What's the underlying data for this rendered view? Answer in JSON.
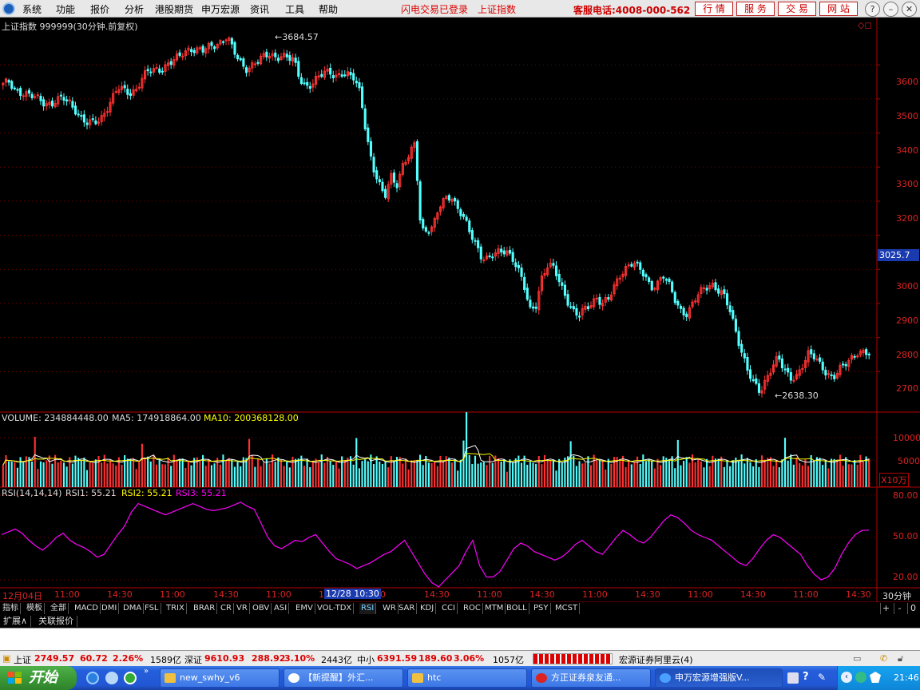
{
  "menubar": {
    "items": [
      "系统",
      "功能",
      "报价",
      "分析",
      "港股期货",
      "申万宏源",
      "资讯",
      "工具",
      "帮助"
    ],
    "notice1": "闪电交易已登录",
    "notice2": "上证指数",
    "hotline": "客服电话:4008-000-562",
    "buttons": [
      "行 情",
      "服 务",
      "交 易",
      "网 站"
    ]
  },
  "chart": {
    "title": "上证指数 999999(30分钟.前复权)",
    "high_label": "3684.57",
    "low_label": "2638.30",
    "current_price": "3025.7",
    "price_ticks": [
      "3600",
      "3500",
      "3400",
      "3300",
      "3200",
      "3100",
      "3000",
      "2900",
      "2800",
      "2700"
    ],
    "volume_label": "VOLUME: 234884448.00",
    "ma5_label": "MA5: 174918864.00",
    "ma10_label": "MA10: 200368128.00",
    "volume_ticks": [
      "10000",
      "5000"
    ],
    "volume_unit": "X10万",
    "rsi_label": "RSI(14,14,14)",
    "rsi1_label": "RSI1: 55.21",
    "rsi2_label": "RSI2: 55.21",
    "rsi3_label": "RSI3: 55.21",
    "rsi_ticks": [
      "80.00",
      "50.00",
      "20.00"
    ],
    "time_labels": [
      "12月04日",
      "11:00",
      "14:30",
      "11:00",
      "14:30",
      "11:00",
      "1",
      "12/28 10:30",
      "0",
      "14:30",
      "11:00",
      "14:30",
      "11:00",
      "14:30",
      "11:00",
      "14:30",
      "11:00",
      "14:30"
    ],
    "period": "30分钟",
    "colors": {
      "up": "#ff3232",
      "down": "#54ffff",
      "ma5": "#ffffff",
      "ma10": "#ffff00",
      "rsi": "#ff00ff",
      "axis": "#b40000"
    }
  },
  "chart_data": {
    "type": "candlestick",
    "title": "上证指数 999999(30分钟.前复权)",
    "ylim": [
      2600,
      3720
    ],
    "close_path": [
      3540,
      3550,
      3530,
      3520,
      3510,
      3505,
      3500,
      3490,
      3485,
      3495,
      3500,
      3490,
      3470,
      3440,
      3425,
      3430,
      3440,
      3470,
      3500,
      3530,
      3525,
      3520,
      3530,
      3560,
      3580,
      3585,
      3590,
      3600,
      3610,
      3620,
      3640,
      3650,
      3645,
      3640,
      3650,
      3660,
      3670,
      3684.57,
      3640,
      3610,
      3590,
      3600,
      3610,
      3620,
      3630,
      3625,
      3630,
      3620,
      3610,
      3560,
      3540,
      3545,
      3560,
      3575,
      3580,
      3570,
      3575,
      3565,
      3560,
      3520,
      3400,
      3300,
      3250,
      3210,
      3280,
      3250,
      3300,
      3330,
      3370,
      3120,
      3115,
      3120,
      3180,
      3210,
      3220,
      3180,
      3150,
      3110,
      3080,
      3040,
      3030,
      3040,
      3050,
      3060,
      3040,
      3000,
      2950,
      2880,
      2900,
      2980,
      3010,
      3000,
      2960,
      2920,
      2880,
      2860,
      2880,
      2900,
      2920,
      2900,
      2910,
      2950,
      2990,
      3010,
      3020,
      3000,
      2980,
      2950,
      2960,
      2980,
      2950,
      2910,
      2880,
      2870,
      2900,
      2930,
      2950,
      2960,
      2940,
      2920,
      2880,
      2820,
      2760,
      2700,
      2660,
      2638.3,
      2680,
      2720,
      2740,
      2700,
      2680,
      2690,
      2720,
      2750,
      2740,
      2720,
      2700,
      2680,
      2700,
      2720,
      2740,
      2760,
      2755,
      2749.57
    ],
    "volume_ticks": [
      10000,
      5000
    ],
    "volume_unit": "X10万",
    "volume": 234884448.0,
    "ma5": 174918864.0,
    "ma10": 200368128.0,
    "rsi_path": [
      52,
      54,
      56,
      53,
      48,
      44,
      41,
      45,
      50,
      53,
      48,
      45,
      43,
      40,
      36,
      38,
      45,
      52,
      58,
      68,
      74,
      72,
      70,
      68,
      66,
      68,
      70,
      72,
      74,
      72,
      70,
      69,
      70,
      71,
      73,
      75,
      72,
      70,
      60,
      50,
      44,
      42,
      45,
      48,
      47,
      50,
      52,
      46,
      40,
      35,
      33,
      31,
      28,
      30,
      32,
      35,
      38,
      40,
      44,
      48,
      40,
      32,
      24,
      18,
      15,
      20,
      25,
      30,
      40,
      48,
      30,
      22,
      22,
      26,
      34,
      42,
      46,
      44,
      40,
      38,
      36,
      34,
      36,
      40,
      45,
      48,
      44,
      40,
      38,
      44,
      50,
      55,
      52,
      48,
      46,
      50,
      56,
      62,
      66,
      64,
      60,
      55,
      52,
      50,
      48,
      44,
      40,
      36,
      32,
      30,
      35,
      42,
      48,
      52,
      50,
      46,
      42,
      38,
      30,
      24,
      20,
      22,
      28,
      38,
      46,
      52,
      55,
      55.21
    ],
    "rsi_ticks": [
      80,
      50,
      20
    ],
    "rsi1": 55.21,
    "rsi2": 55.21,
    "rsi3": 55.21
  },
  "tabs": [
    "指标",
    "模板",
    "全部",
    "MACD",
    "DMI",
    "DMA",
    "FSL",
    "TRIX",
    "BRAR",
    "CR",
    "VR",
    "OBV",
    "ASI",
    "EMV",
    "VOL-TDX",
    "RSI",
    "WR",
    "SAR",
    "KDJ",
    "CCI",
    "ROC",
    "MTM",
    "BOLL",
    "PSY",
    "MCST"
  ],
  "active_tab": "RSI",
  "tab_controls": [
    "+",
    "-",
    "0"
  ],
  "ext_tabs": [
    "扩展∧",
    "关联报价"
  ],
  "statusbar": {
    "sh_name": "上证",
    "sh_value": "2749.57",
    "sh_change": "60.72",
    "sh_pct": "2.26%",
    "sh_amount": "1589亿",
    "sz_name": "深证",
    "sz_value": "9610.93",
    "sz_change": "288.92",
    "sz_pct": "3.10%",
    "sz_amount": "2443亿",
    "zx_name": "中小",
    "zx_value": "6391.59",
    "zx_change": "189.60",
    "zx_pct": "3.06%",
    "zx_amount": "1057亿",
    "server": "宏源证券阿里云(4)"
  },
  "taskbar": {
    "start": "开始",
    "tasks": [
      "new_swhy_v6",
      "【新提醒】外汇...",
      "htc",
      "方正证券泉友通...",
      "申万宏源增强版V..."
    ],
    "clock": "21:46"
  }
}
